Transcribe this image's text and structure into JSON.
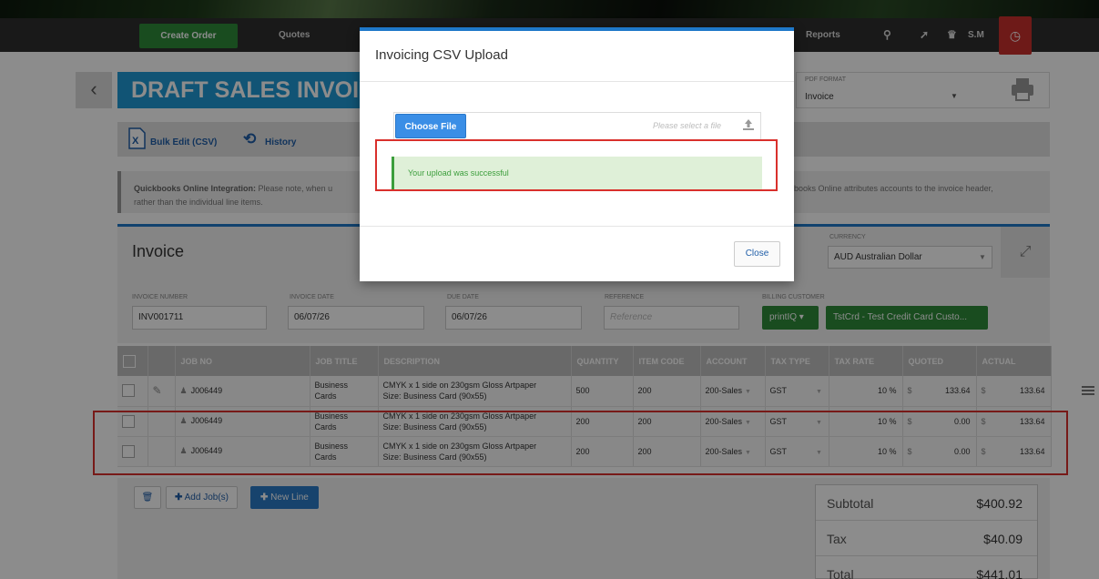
{
  "nav": {
    "create_order": "Create Order",
    "quotes": "Quotes",
    "reports": "Reports",
    "user_initials": "S.M"
  },
  "page": {
    "title": "DRAFT SALES INVOI",
    "pdf_format_label": "PDF FORMAT",
    "pdf_format_value": "Invoice"
  },
  "toolbar": {
    "bulk_edit": "Bulk Edit (CSV)",
    "history": "History"
  },
  "notice": {
    "bold": "Quickbooks Online Integration:",
    "text_left": " Please note, when u",
    "text_right": "ickbooks Online attributes accounts to the invoice header,",
    "line2": "rather than the individual line items."
  },
  "invoice": {
    "section_title": "Invoice",
    "currency_label": "CURRENCY",
    "currency_value": "AUD Australian Dollar",
    "invoice_number_label": "INVOICE NUMBER",
    "invoice_number": "INV001711",
    "invoice_date_label": "INVOICE DATE",
    "invoice_date": "06/07/26",
    "due_date_label": "DUE DATE",
    "due_date": "06/07/26",
    "reference_label": "REFERENCE",
    "reference_placeholder": "Reference",
    "billing_customer_label": "BILLING CUSTOMER",
    "billing_company": "printIQ",
    "billing_customer": "TstCrd - Test Credit Card Custo..."
  },
  "table": {
    "headers": [
      "JOB NO",
      "JOB TITLE",
      "DESCRIPTION",
      "QUANTITY",
      "ITEM CODE",
      "ACCOUNT",
      "TAX TYPE",
      "TAX RATE",
      "QUOTED",
      "ACTUAL"
    ],
    "rows": [
      {
        "job_no": "J006449",
        "title_1": "Business",
        "title_2": "Cards",
        "desc_1": "CMYK x 1 side on 230gsm Gloss Artpaper",
        "desc_2": "Size: Business Card (90x55)",
        "quantity": "500",
        "item_code": "200",
        "account": "200-Sales",
        "tax_type": "GST",
        "tax_rate": "10 %",
        "quoted": "133.64",
        "actual": "133.64"
      },
      {
        "job_no": "J006449",
        "title_1": "Business",
        "title_2": "Cards",
        "desc_1": "CMYK x 1 side on 230gsm Gloss Artpaper",
        "desc_2": "Size: Business Card (90x55)",
        "quantity": "200",
        "item_code": "200",
        "account": "200-Sales",
        "tax_type": "GST",
        "tax_rate": "10 %",
        "quoted": "0.00",
        "actual": "133.64"
      },
      {
        "job_no": "J006449",
        "title_1": "Business",
        "title_2": "Cards",
        "desc_1": "CMYK x 1 side on 230gsm Gloss Artpaper",
        "desc_2": "Size: Business Card (90x55)",
        "quantity": "200",
        "item_code": "200",
        "account": "200-Sales",
        "tax_type": "GST",
        "tax_rate": "10 %",
        "quoted": "0.00",
        "actual": "133.64"
      }
    ],
    "currency_symbol": "$"
  },
  "actions": {
    "add_jobs": "Add Job(s)",
    "new_line": "New Line"
  },
  "totals": {
    "subtotal_label": "Subtotal",
    "subtotal": "$400.92",
    "tax_label": "Tax",
    "tax": "$40.09",
    "total_label": "Total",
    "total": "$441.01"
  },
  "modal": {
    "title": "Invoicing CSV Upload",
    "choose_file": "Choose File",
    "file_placeholder": "Please select a file",
    "success_message": "Your upload was successful",
    "close": "Close"
  },
  "colors": {
    "accent_blue": "#1f9ad6",
    "success_green": "#3c9e3c",
    "highlight_red": "#d9302c"
  }
}
